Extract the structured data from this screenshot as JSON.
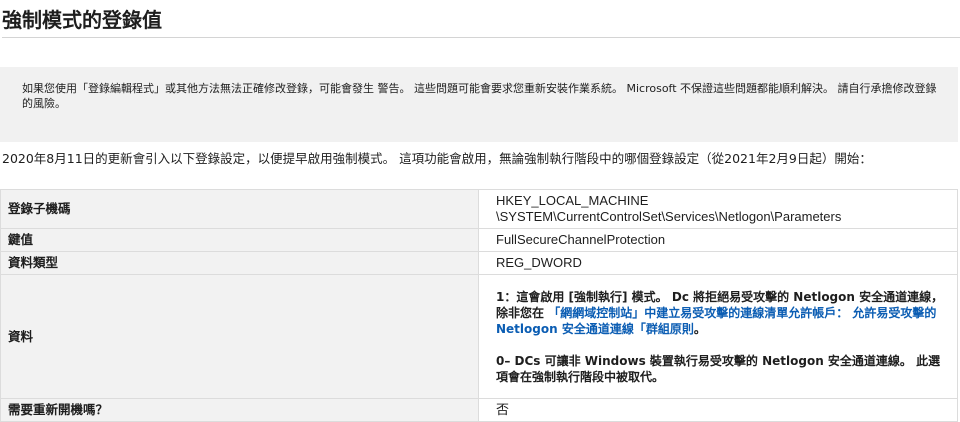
{
  "page": {
    "title": "強制模式的登錄值",
    "warning": "如果您使用「登錄編輯程式」或其他方法無法正確修改登錄，可能會發生 警告。 這些問題可能會要求您重新安裝作業系統。 Microsoft 不保證這些問題都能順利解決。 請自行承擔修改登錄的風險。",
    "intro": "2020年8月11日的更新會引入以下登錄設定，以便提早啟用強制模式。 這項功能會啟用，無論強制執行階段中的哪個登錄設定（從2021年2月9日起）開始："
  },
  "registry_table": {
    "rows": [
      {
        "key": "登錄子機碼",
        "value_line1": "HKEY_LOCAL_MACHINE",
        "value_line2": "\\SYSTEM\\CurrentControlSet\\Services\\Netlogon\\Parameters"
      },
      {
        "key": "鍵值",
        "value": "FullSecureChannelProtection"
      },
      {
        "key": "資料類型",
        "value": "REG_DWORD"
      },
      {
        "key": "資料",
        "data_1_prefix": "1：這會啟用 [強制執行] 模式。 Dc 將拒絕易受攻擊的 Netlogon 安全通道連線，除非您在",
        "data_1_link": "「網網域控制站」中建立易受攻擊的連線清單允許帳戶： 允許易受攻擊的 Netlogon 安全通道連線「群組原則",
        "data_1_suffix": "。",
        "data_0": "0– DCs 可讓非 Windows 裝置執行易受攻擊的 Netlogon 安全通道連線。 此選項會在強制執行階段中被取代。"
      },
      {
        "key": "需要重新開機嗎？",
        "value": "否"
      }
    ]
  }
}
